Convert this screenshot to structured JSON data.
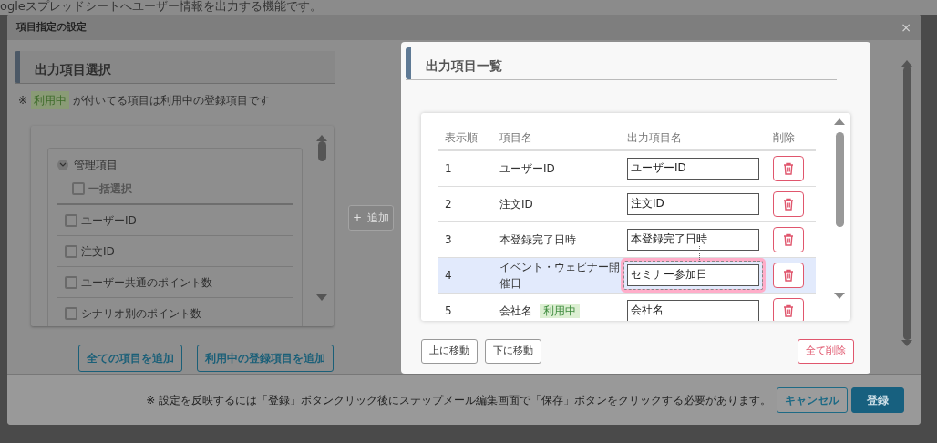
{
  "background_text": "ogleスプレッドシートへユーザー情報を出力する機能です。",
  "dialog": {
    "title": "項目指定の設定",
    "close": "×"
  },
  "left_panel": {
    "heading": "出力項目選択",
    "note_prefix": "※",
    "note_badge": "利用中",
    "note_text": "が付いてる項目は利用中の登録項目です",
    "group": {
      "label": "管理項目",
      "expanded": true,
      "items": [
        {
          "label": "一括選択",
          "kind": "select-all",
          "checked": false
        },
        {
          "label": "ユーザーID",
          "kind": "item",
          "checked": false
        },
        {
          "label": "注文ID",
          "kind": "item",
          "checked": false
        },
        {
          "label": "ユーザー共通のポイント数",
          "kind": "item",
          "checked": false
        },
        {
          "label": "シナリオ別のポイント数",
          "kind": "item",
          "checked": false
        }
      ]
    },
    "buttons": [
      "全ての項目を追加",
      "利用中の登録項目を追加"
    ]
  },
  "add_button": {
    "icon": "+",
    "label": "追加"
  },
  "right_panel": {
    "heading": "出力項目一覧",
    "columns": [
      "表示順",
      "項目名",
      "出力項目名",
      "削除"
    ],
    "rows": [
      {
        "order": "1",
        "name": "ユーザーID",
        "output": "ユーザーID",
        "selected": false,
        "highlighted": false
      },
      {
        "order": "2",
        "name": "注文ID",
        "output": "注文ID",
        "selected": false,
        "highlighted": false
      },
      {
        "order": "3",
        "name": "本登録完了日時",
        "output": "本登録完了日時",
        "selected": false,
        "highlighted": false
      },
      {
        "order": "4",
        "name": "イベント・ウェビナー開催日",
        "output": "セミナー参加日",
        "selected": true,
        "highlighted": true
      },
      {
        "order": "5",
        "name": "会社名",
        "badge": "利用中",
        "output": "会社名",
        "selected": false,
        "highlighted": false
      }
    ],
    "move_up": "上に移動",
    "move_down": "下に移動",
    "delete_all": "全て削除"
  },
  "footer": {
    "note": "※ 設定を反映するには「登録」ボタンクリック後にステップメール編集画面で「保存」ボタンをクリックする必要があります。",
    "cancel": "キャンセル",
    "submit": "登録"
  }
}
